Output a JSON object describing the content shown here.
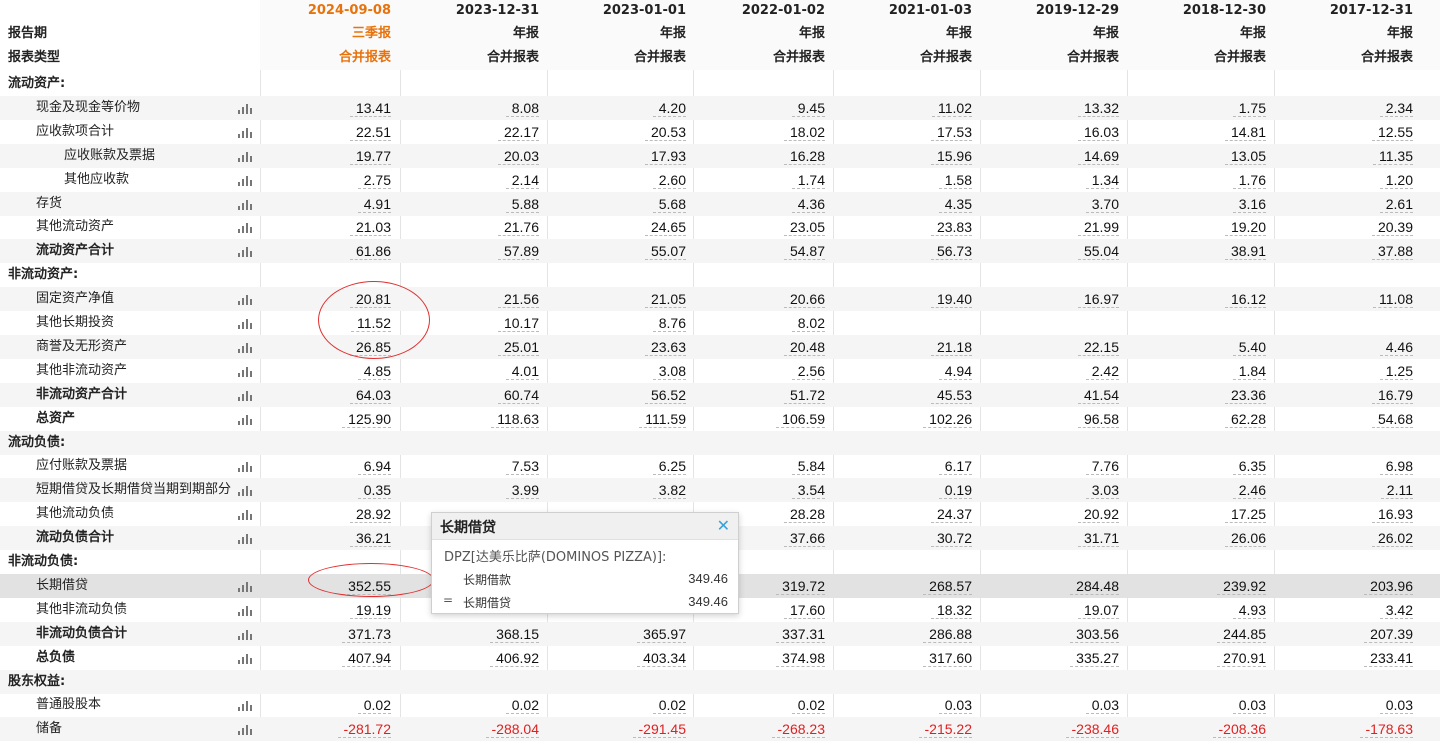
{
  "header": {
    "period_label": "报告期",
    "type_label": "报表类型",
    "columns": [
      {
        "date": "2024-09-08",
        "kind": "三季报",
        "report": "合并报表"
      },
      {
        "date": "2023-12-31",
        "kind": "年报",
        "report": "合并报表"
      },
      {
        "date": "2023-01-01",
        "kind": "年报",
        "report": "合并报表"
      },
      {
        "date": "2022-01-02",
        "kind": "年报",
        "report": "合并报表"
      },
      {
        "date": "2021-01-03",
        "kind": "年报",
        "report": "合并报表"
      },
      {
        "date": "2019-12-29",
        "kind": "年报",
        "report": "合并报表"
      },
      {
        "date": "2018-12-30",
        "kind": "年报",
        "report": "合并报表"
      },
      {
        "date": "2017-12-31",
        "kind": "年报",
        "report": "合并报表"
      }
    ]
  },
  "rows": [
    {
      "label": "流动资产:",
      "level": 0,
      "bold": true,
      "section": true,
      "values": []
    },
    {
      "label": "现金及现金等价物",
      "level": 1,
      "values": [
        "13.41",
        "8.08",
        "4.20",
        "9.45",
        "11.02",
        "13.32",
        "1.75",
        "2.34"
      ]
    },
    {
      "label": "应收款项合计",
      "level": 1,
      "values": [
        "22.51",
        "22.17",
        "20.53",
        "18.02",
        "17.53",
        "16.03",
        "14.81",
        "12.55"
      ]
    },
    {
      "label": "应收账款及票据",
      "level": 2,
      "values": [
        "19.77",
        "20.03",
        "17.93",
        "16.28",
        "15.96",
        "14.69",
        "13.05",
        "11.35"
      ]
    },
    {
      "label": "其他应收款",
      "level": 2,
      "values": [
        "2.75",
        "2.14",
        "2.60",
        "1.74",
        "1.58",
        "1.34",
        "1.76",
        "1.20"
      ]
    },
    {
      "label": "存货",
      "level": 1,
      "values": [
        "4.91",
        "5.88",
        "5.68",
        "4.36",
        "4.35",
        "3.70",
        "3.16",
        "2.61"
      ]
    },
    {
      "label": "其他流动资产",
      "level": 1,
      "values": [
        "21.03",
        "21.76",
        "24.65",
        "23.05",
        "23.83",
        "21.99",
        "19.20",
        "20.39"
      ]
    },
    {
      "label": "流动资产合计",
      "level": 1,
      "bold": true,
      "values": [
        "61.86",
        "57.89",
        "55.07",
        "54.87",
        "56.73",
        "55.04",
        "38.91",
        "37.88"
      ]
    },
    {
      "label": "非流动资产:",
      "level": 0,
      "bold": true,
      "section": true,
      "values": []
    },
    {
      "label": "固定资产净值",
      "level": 1,
      "values": [
        "20.81",
        "21.56",
        "21.05",
        "20.66",
        "19.40",
        "16.97",
        "16.12",
        "11.08"
      ]
    },
    {
      "label": "其他长期投资",
      "level": 1,
      "values": [
        "11.52",
        "10.17",
        "8.76",
        "8.02",
        "",
        "",
        "",
        ""
      ]
    },
    {
      "label": "商誉及无形资产",
      "level": 1,
      "values": [
        "26.85",
        "25.01",
        "23.63",
        "20.48",
        "21.18",
        "22.15",
        "5.40",
        "4.46"
      ]
    },
    {
      "label": "其他非流动资产",
      "level": 1,
      "values": [
        "4.85",
        "4.01",
        "3.08",
        "2.56",
        "4.94",
        "2.42",
        "1.84",
        "1.25"
      ]
    },
    {
      "label": "非流动资产合计",
      "level": 1,
      "bold": true,
      "values": [
        "64.03",
        "60.74",
        "56.52",
        "51.72",
        "45.53",
        "41.54",
        "23.36",
        "16.79"
      ]
    },
    {
      "label": "总资产",
      "level": 1,
      "bold": true,
      "values": [
        "125.90",
        "118.63",
        "111.59",
        "106.59",
        "102.26",
        "96.58",
        "62.28",
        "54.68"
      ]
    },
    {
      "label": "流动负债:",
      "level": 0,
      "bold": true,
      "section": true,
      "values": []
    },
    {
      "label": "应付账款及票据",
      "level": 1,
      "values": [
        "6.94",
        "7.53",
        "6.25",
        "5.84",
        "6.17",
        "7.76",
        "6.35",
        "6.98"
      ]
    },
    {
      "label": "短期借贷及长期借贷当期到期部分",
      "level": 1,
      "values": [
        "0.35",
        "3.99",
        "3.82",
        "3.54",
        "0.19",
        "3.03",
        "2.46",
        "2.11"
      ]
    },
    {
      "label": "其他流动负债",
      "level": 1,
      "values": [
        "28.92",
        "",
        "",
        "28.28",
        "24.37",
        "20.92",
        "17.25",
        "16.93"
      ]
    },
    {
      "label": "流动负债合计",
      "level": 1,
      "bold": true,
      "values": [
        "36.21",
        "",
        "",
        "37.66",
        "30.72",
        "31.71",
        "26.06",
        "26.02"
      ]
    },
    {
      "label": "非流动负债:",
      "level": 0,
      "bold": true,
      "section": true,
      "values": []
    },
    {
      "label": "长期借贷",
      "level": 1,
      "highlight": true,
      "values": [
        "352.55",
        "",
        "",
        "319.72",
        "268.57",
        "284.48",
        "239.92",
        "203.96"
      ]
    },
    {
      "label": "其他非流动负债",
      "level": 1,
      "values": [
        "19.19",
        "",
        "",
        "17.60",
        "18.32",
        "19.07",
        "4.93",
        "3.42"
      ]
    },
    {
      "label": "非流动负债合计",
      "level": 1,
      "bold": true,
      "values": [
        "371.73",
        "368.15",
        "365.97",
        "337.31",
        "286.88",
        "303.56",
        "244.85",
        "207.39"
      ]
    },
    {
      "label": "总负债",
      "level": 1,
      "bold": true,
      "values": [
        "407.94",
        "406.92",
        "403.34",
        "374.98",
        "317.60",
        "335.27",
        "270.91",
        "233.41"
      ]
    },
    {
      "label": "股东权益:",
      "level": 0,
      "bold": true,
      "section": true,
      "values": []
    },
    {
      "label": "普通股股本",
      "level": 1,
      "values": [
        "0.02",
        "0.02",
        "0.02",
        "0.02",
        "0.03",
        "0.03",
        "0.03",
        "0.03"
      ]
    },
    {
      "label": "储备",
      "level": 1,
      "values": [
        "-281.72",
        "-288.04",
        "-291.45",
        "-268.23",
        "-215.22",
        "-238.46",
        "-208.36",
        "-178.63"
      ]
    }
  ],
  "tooltip": {
    "title": "长期借贷",
    "close_icon": "close-icon",
    "subtitle": "DPZ[达美乐比萨(DOMINOS PIZZA)]:",
    "lines": [
      {
        "name": "长期借款",
        "value": "349.46",
        "prefix": ""
      },
      {
        "name": "长期借贷",
        "value": "349.46",
        "prefix": "="
      }
    ]
  },
  "colors": {
    "accent_orange": "#e8720c",
    "negative_red": "#e02020",
    "annotation_red": "#e03030",
    "close_blue": "#3aa0d8"
  }
}
